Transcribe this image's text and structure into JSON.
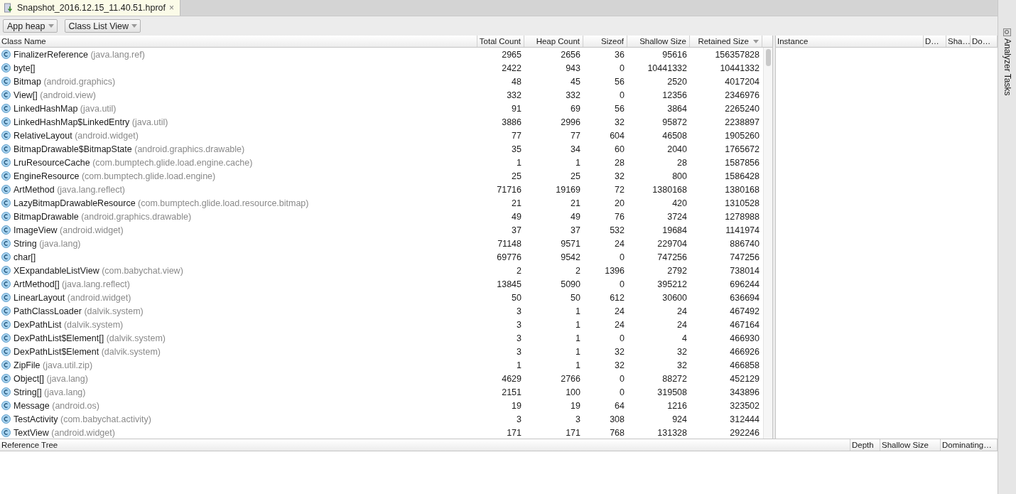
{
  "tab": {
    "title": "Snapshot_2016.12.15_11.40.51.hprof",
    "close": "×"
  },
  "toolbar": {
    "dropdowns": [
      "App heap",
      "Class List View"
    ]
  },
  "class_table": {
    "columns": [
      {
        "label": "Class Name",
        "sorted": false
      },
      {
        "label": "Total Count",
        "sorted": false
      },
      {
        "label": "Heap Count",
        "sorted": false
      },
      {
        "label": "Sizeof",
        "sorted": false
      },
      {
        "label": "Shallow Size",
        "sorted": false
      },
      {
        "label": "Retained Size",
        "sorted": true
      }
    ],
    "rows": [
      {
        "package": "(java.lang.ref)",
        "cells": [
          "FinalizerReference",
          "2965",
          "2656",
          "36",
          "95616",
          "156357828"
        ]
      },
      {
        "cells": [
          "byte[]",
          "2422",
          "943",
          "0",
          "10441332",
          "10441332"
        ]
      },
      {
        "package": "(android.graphics)",
        "cells": [
          "Bitmap",
          "48",
          "45",
          "56",
          "2520",
          "4017204"
        ]
      },
      {
        "package": "(android.view)",
        "cells": [
          "View[]",
          "332",
          "332",
          "0",
          "12356",
          "2346976"
        ]
      },
      {
        "package": "(java.util)",
        "cells": [
          "LinkedHashMap",
          "91",
          "69",
          "56",
          "3864",
          "2265240"
        ]
      },
      {
        "package": "(java.util)",
        "cells": [
          "LinkedHashMap$LinkedEntry",
          "3886",
          "2996",
          "32",
          "95872",
          "2238897"
        ]
      },
      {
        "package": "(android.widget)",
        "cells": [
          "RelativeLayout",
          "77",
          "77",
          "604",
          "46508",
          "1905260"
        ]
      },
      {
        "package": "(android.graphics.drawable)",
        "cells": [
          "BitmapDrawable$BitmapState",
          "35",
          "34",
          "60",
          "2040",
          "1765672"
        ]
      },
      {
        "package": "(com.bumptech.glide.load.engine.cache)",
        "cells": [
          "LruResourceCache",
          "1",
          "1",
          "28",
          "28",
          "1587856"
        ]
      },
      {
        "package": "(com.bumptech.glide.load.engine)",
        "cells": [
          "EngineResource",
          "25",
          "25",
          "32",
          "800",
          "1586428"
        ]
      },
      {
        "package": "(java.lang.reflect)",
        "cells": [
          "ArtMethod",
          "71716",
          "19169",
          "72",
          "1380168",
          "1380168"
        ]
      },
      {
        "package": "(com.bumptech.glide.load.resource.bitmap)",
        "cells": [
          "LazyBitmapDrawableResource",
          "21",
          "21",
          "20",
          "420",
          "1310528"
        ]
      },
      {
        "package": "(android.graphics.drawable)",
        "cells": [
          "BitmapDrawable",
          "49",
          "49",
          "76",
          "3724",
          "1278988"
        ]
      },
      {
        "package": "(android.widget)",
        "cells": [
          "ImageView",
          "37",
          "37",
          "532",
          "19684",
          "1141974"
        ]
      },
      {
        "package": "(java.lang)",
        "cells": [
          "String",
          "71148",
          "9571",
          "24",
          "229704",
          "886740"
        ]
      },
      {
        "cells": [
          "char[]",
          "69776",
          "9542",
          "0",
          "747256",
          "747256"
        ]
      },
      {
        "package": "(com.babychat.view)",
        "cells": [
          "XExpandableListView",
          "2",
          "2",
          "1396",
          "2792",
          "738014"
        ]
      },
      {
        "package": "(java.lang.reflect)",
        "cells": [
          "ArtMethod[]",
          "13845",
          "5090",
          "0",
          "395212",
          "696244"
        ]
      },
      {
        "package": "(android.widget)",
        "cells": [
          "LinearLayout",
          "50",
          "50",
          "612",
          "30600",
          "636694"
        ]
      },
      {
        "package": "(dalvik.system)",
        "cells": [
          "PathClassLoader",
          "3",
          "1",
          "24",
          "24",
          "467492"
        ]
      },
      {
        "package": "(dalvik.system)",
        "cells": [
          "DexPathList",
          "3",
          "1",
          "24",
          "24",
          "467164"
        ]
      },
      {
        "package": "(dalvik.system)",
        "cells": [
          "DexPathList$Element[]",
          "3",
          "1",
          "0",
          "4",
          "466930"
        ]
      },
      {
        "package": "(dalvik.system)",
        "cells": [
          "DexPathList$Element",
          "3",
          "1",
          "32",
          "32",
          "466926"
        ]
      },
      {
        "package": "(java.util.zip)",
        "cells": [
          "ZipFile",
          "1",
          "1",
          "32",
          "32",
          "466858"
        ]
      },
      {
        "package": "(java.lang)",
        "cells": [
          "Object[]",
          "4629",
          "2766",
          "0",
          "88272",
          "452129"
        ]
      },
      {
        "package": "(java.lang)",
        "cells": [
          "String[]",
          "2151",
          "100",
          "0",
          "319508",
          "343896"
        ]
      },
      {
        "package": "(android.os)",
        "cells": [
          "Message",
          "19",
          "19",
          "64",
          "1216",
          "323502"
        ]
      },
      {
        "package": "(com.babychat.activity)",
        "cells": [
          "TestActivity",
          "3",
          "3",
          "308",
          "924",
          "312444"
        ]
      },
      {
        "package": "(android.widget)",
        "cells": [
          "TextView",
          "171",
          "171",
          "768",
          "131328",
          "292246"
        ]
      }
    ]
  },
  "instance_table": {
    "columns": [
      "Instance",
      "D…",
      "Sha…",
      "Do…"
    ]
  },
  "reference_tree": {
    "columns": [
      "Reference Tree",
      "Depth",
      "Shallow Size",
      "Dominating…"
    ]
  },
  "side_tool": {
    "label": "Analyzer Tasks"
  }
}
